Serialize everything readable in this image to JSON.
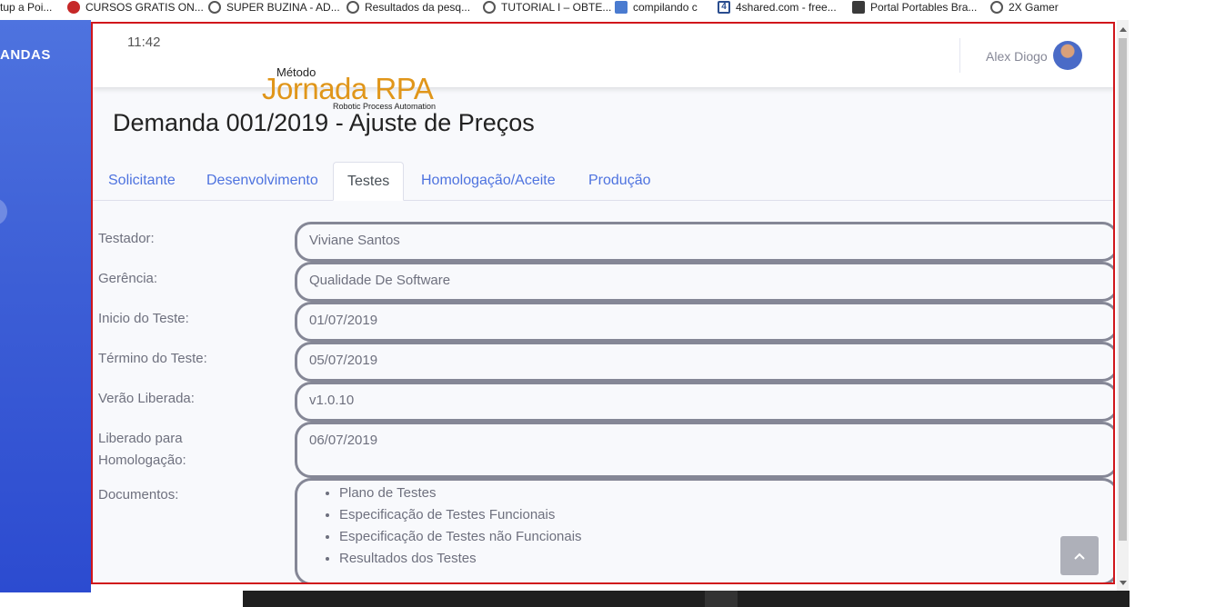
{
  "bookmarks": [
    {
      "label": "tup a Poi...",
      "icon": "none"
    },
    {
      "label": "CURSOS GRATIS ON...",
      "icon": "red-badge-icon"
    },
    {
      "label": "SUPER BUZINA - AD...",
      "icon": "globe-icon"
    },
    {
      "label": "Resultados da pesq...",
      "icon": "globe-icon"
    },
    {
      "label": "TUTORIAL I – OBTE...",
      "icon": "globe-icon"
    },
    {
      "label": "compilando c",
      "icon": "translate-icon"
    },
    {
      "label": "4shared.com - free...",
      "icon": "4shared-icon"
    },
    {
      "label": "Portal Portables Bra...",
      "icon": "portal-icon"
    },
    {
      "label": "2X Gamer",
      "icon": "wordpress-icon"
    }
  ],
  "sidebar": {
    "title": "ANDAS"
  },
  "topbar": {
    "time": "11:42",
    "user_name": "Alex Diogo"
  },
  "logo": {
    "top": "Método",
    "main": "Jornada RPA",
    "sub": "Robotic Process Automation"
  },
  "page_title": "Demanda 001/2019 - Ajuste de Preços",
  "tabs": [
    {
      "label": "Solicitante",
      "active": false
    },
    {
      "label": "Desenvolvimento",
      "active": false
    },
    {
      "label": "Testes",
      "active": true
    },
    {
      "label": "Homologação/Aceite",
      "active": false
    },
    {
      "label": "Produção",
      "active": false
    }
  ],
  "form": {
    "testador": {
      "label": "Testador:",
      "value": "Viviane Santos"
    },
    "gerencia": {
      "label": "Gerência:",
      "value": "Qualidade De Software"
    },
    "inicio": {
      "label": "Inicio do Teste:",
      "value": "01/07/2019"
    },
    "termino": {
      "label": "Término do Teste:",
      "value": "05/07/2019"
    },
    "versao": {
      "label": "Verão Liberada:",
      "value": "v1.0.10"
    },
    "liberado": {
      "label_line1": "Liberado para",
      "label_line2": "Homologação:",
      "value": "06/07/2019"
    },
    "documentos": {
      "label": "Documentos:",
      "items": [
        "Plano de Testes",
        "Especificação de Testes Funcionais",
        "Especificação de Testes não Funcionais",
        "Resultados dos Testes"
      ]
    }
  },
  "colors": {
    "sidebar": "#4e73df",
    "highlight_border": "#d0161b",
    "tab_link": "#4e73df",
    "logo_orange": "#e0961a"
  }
}
